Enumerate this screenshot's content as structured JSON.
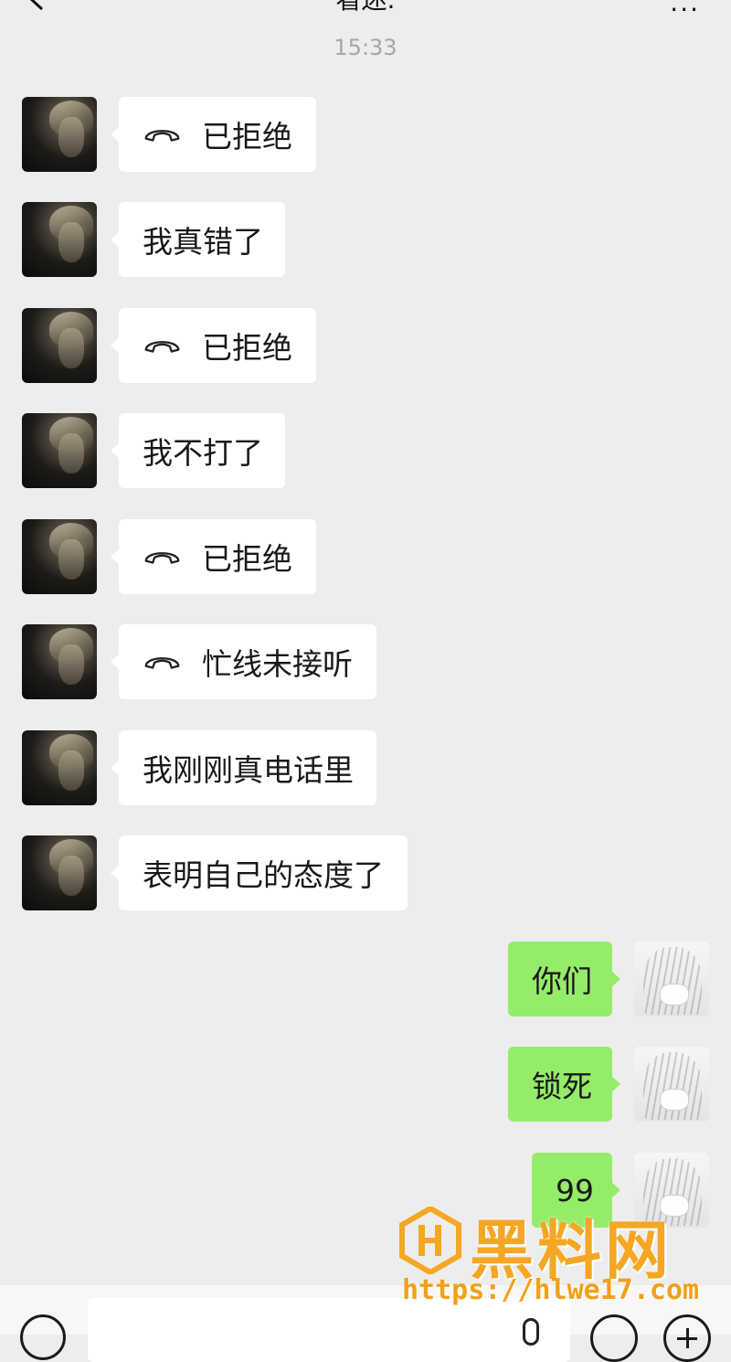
{
  "header": {
    "title": "看迷.",
    "more_label": "···"
  },
  "chat": {
    "time": "15:33",
    "incoming": [
      {
        "type": "call",
        "text": "已拒绝"
      },
      {
        "type": "text",
        "text": "我真错了"
      },
      {
        "type": "call",
        "text": "已拒绝"
      },
      {
        "type": "text",
        "text": "我不打了"
      },
      {
        "type": "call",
        "text": "已拒绝"
      },
      {
        "type": "call",
        "text": "忙线未接听"
      },
      {
        "type": "text",
        "text": "我刚刚真电话里"
      },
      {
        "type": "text",
        "text": "表明自己的态度了"
      },
      {
        "type": "text",
        "text": ""
      }
    ],
    "outgoing": [
      {
        "type": "text",
        "text": "你们"
      },
      {
        "type": "text",
        "text": "锁死"
      },
      {
        "type": "text",
        "text": "99"
      }
    ]
  },
  "watermark": {
    "name": "黑料网",
    "url": "https://hlwe17.com"
  },
  "colors": {
    "background": "#ededed",
    "incoming_bubble": "#ffffff",
    "outgoing_bubble": "#95ec69",
    "watermark": "#f5a623"
  }
}
